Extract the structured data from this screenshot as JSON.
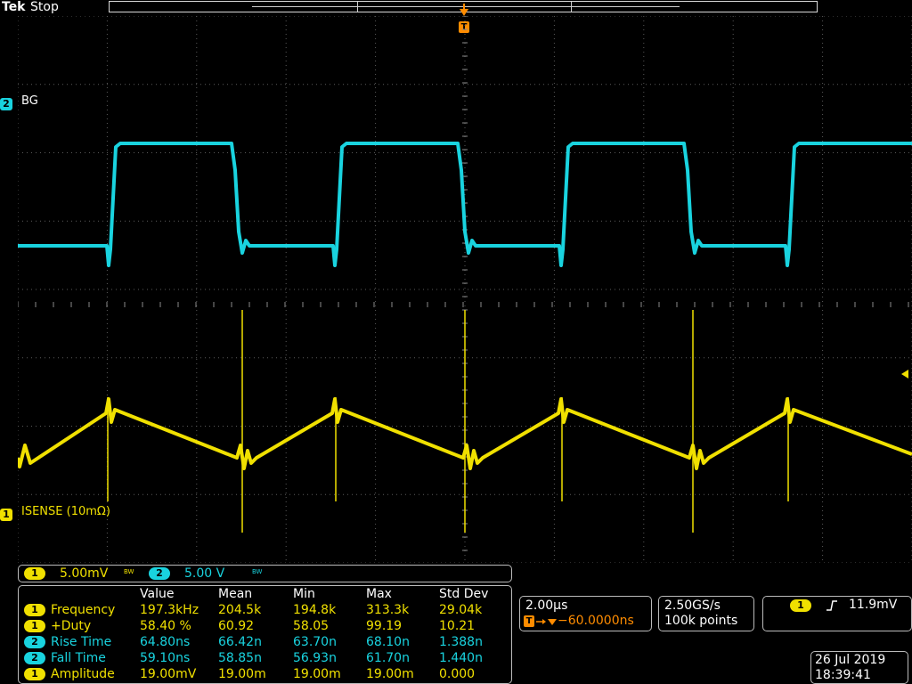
{
  "status": {
    "brand": "Tek",
    "run_state": "Stop"
  },
  "channels": {
    "ch2": {
      "number": "2",
      "label": "BG",
      "color": "#19d3df"
    },
    "ch1": {
      "number": "1",
      "label": "ISENSE (10mΩ)",
      "color": "#f0e000"
    }
  },
  "trigger_marker": "T",
  "scale": {
    "ch1_num": "1",
    "ch1_scale": "5.00mV",
    "ch1_bw": "BW",
    "ch2_num": "2",
    "ch2_scale": "5.00 V",
    "ch2_bw": "BW"
  },
  "measurements": {
    "headers": [
      "Value",
      "Mean",
      "Min",
      "Max",
      "Std Dev"
    ],
    "rows": [
      {
        "ch": "1",
        "name": "Frequency",
        "value": "197.3kHz",
        "mean": "204.5k",
        "min": "194.8k",
        "max": "313.3k",
        "std": "29.04k"
      },
      {
        "ch": "1",
        "name": "+Duty",
        "value": "58.40 %",
        "mean": "60.92",
        "min": "58.05",
        "max": "99.19",
        "std": "10.21"
      },
      {
        "ch": "2",
        "name": "Rise Time",
        "value": "64.80ns",
        "mean": "66.42n",
        "min": "63.70n",
        "max": "68.10n",
        "std": "1.388n"
      },
      {
        "ch": "2",
        "name": "Fall Time",
        "value": "59.10ns",
        "mean": "58.85n",
        "min": "56.93n",
        "max": "61.70n",
        "std": "1.440n"
      },
      {
        "ch": "1",
        "name": "Amplitude",
        "value": "19.00mV",
        "mean": "19.00m",
        "min": "19.00m",
        "max": "19.00m",
        "std": "0.000"
      }
    ]
  },
  "horizontal": {
    "timebase": "2.00µs",
    "delay": "−60.0000ns",
    "delay_icon": "T",
    "sample_rate": "2.50GS/s",
    "record_length": "100k points"
  },
  "trigger": {
    "ch": "1",
    "slope_icon": "rising-edge",
    "level": "11.9mV"
  },
  "datetime": {
    "date": "26 Jul  2019",
    "time": "18:39:41"
  }
}
